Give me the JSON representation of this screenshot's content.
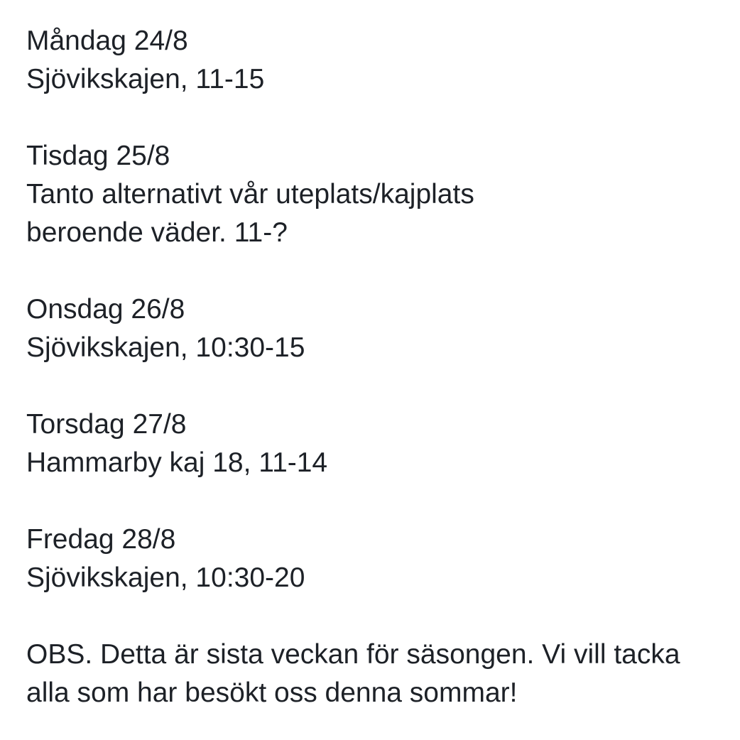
{
  "schedule": [
    {
      "day": "Måndag 24/8",
      "lines": [
        "Sjövikskajen, 11-15"
      ]
    },
    {
      "day": "Tisdag 25/8",
      "lines": [
        "Tanto alternativt vår uteplats/kajplats",
        "beroende väder. 11-?"
      ]
    },
    {
      "day": "Onsdag 26/8",
      "lines": [
        "Sjövikskajen, 10:30-15"
      ]
    },
    {
      "day": "Torsdag 27/8",
      "lines": [
        "Hammarby kaj 18, 11-14"
      ]
    },
    {
      "day": "Fredag 28/8",
      "lines": [
        "Sjövikskajen, 10:30-20"
      ]
    }
  ],
  "note": {
    "lines": [
      "OBS. Detta är sista veckan för säsongen. Vi vill tacka",
      "alla som har besökt oss denna sommar!"
    ]
  },
  "colors": {
    "text": "#1d2127",
    "background": "#ffffff"
  }
}
